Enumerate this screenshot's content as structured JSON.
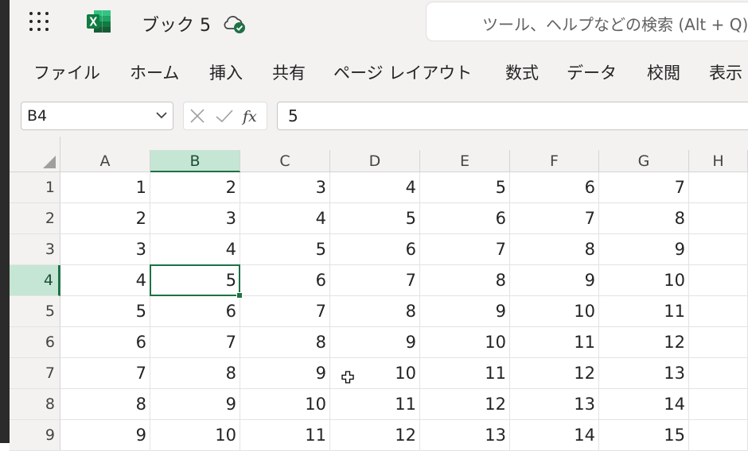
{
  "app": {
    "title": "ブック 5",
    "search_placeholder": "ツール、ヘルプなどの検索 (Alt + Q)"
  },
  "colors": {
    "accent": "#1e7145",
    "selected_header_bg": "#c5e6d4",
    "chrome_bg": "#f3f2f1"
  },
  "icons": [
    "app-launcher-icon",
    "excel-logo-icon",
    "cloud-saved-icon",
    "chevron-down-icon",
    "cancel-x-icon",
    "enter-check-icon",
    "fx-icon",
    "select-all-triangle-icon",
    "cell-select-cursor-icon"
  ],
  "menu": [
    "ファイル",
    "ホーム",
    "挿入",
    "共有",
    "ページ レイアウト",
    "数式",
    "データ",
    "校閲",
    "表示"
  ],
  "formula_bar": {
    "name_box": "B4",
    "formula": "5",
    "fx_label": "fx"
  },
  "sheet": {
    "columns": [
      "A",
      "B",
      "C",
      "D",
      "E",
      "F",
      "G",
      "H"
    ],
    "rows": [
      "1",
      "2",
      "3",
      "4",
      "5",
      "6",
      "7",
      "8",
      "9"
    ],
    "cells": [
      [
        "1",
        "2",
        "3",
        "4",
        "5",
        "6",
        "7",
        ""
      ],
      [
        "2",
        "3",
        "4",
        "5",
        "6",
        "7",
        "8",
        ""
      ],
      [
        "3",
        "4",
        "5",
        "6",
        "7",
        "8",
        "9",
        ""
      ],
      [
        "4",
        "5",
        "6",
        "7",
        "8",
        "9",
        "10",
        ""
      ],
      [
        "5",
        "6",
        "7",
        "8",
        "9",
        "10",
        "11",
        ""
      ],
      [
        "6",
        "7",
        "8",
        "9",
        "10",
        "11",
        "12",
        ""
      ],
      [
        "7",
        "8",
        "9",
        "10",
        "11",
        "12",
        "13",
        ""
      ],
      [
        "8",
        "9",
        "10",
        "11",
        "12",
        "13",
        "14",
        ""
      ],
      [
        "9",
        "10",
        "11",
        "12",
        "13",
        "14",
        "15",
        ""
      ]
    ],
    "active_cell": "B4"
  }
}
